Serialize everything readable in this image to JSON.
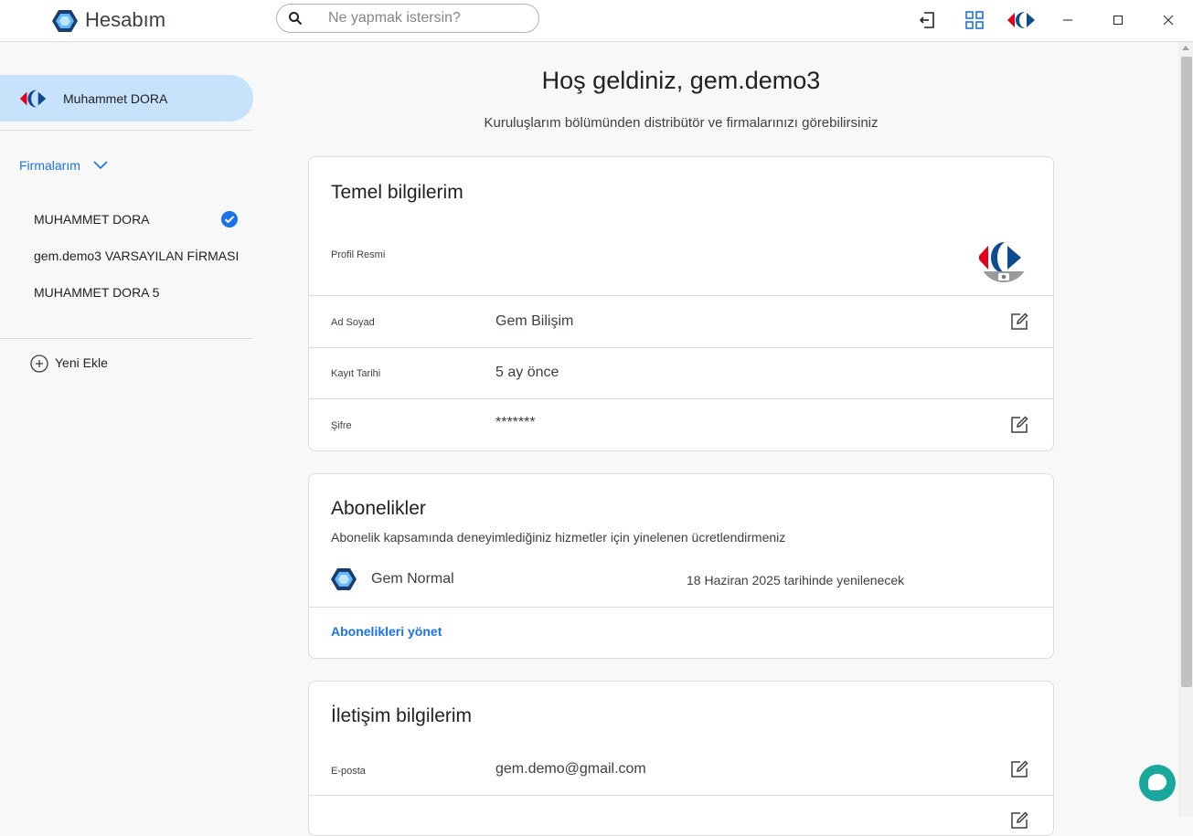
{
  "app": {
    "title": "Hesabım"
  },
  "search": {
    "placeholder": "Ne yapmak istersin?"
  },
  "sidebar": {
    "user_name": "Muhammet DORA",
    "firms_label": "Firmalarım",
    "firms": [
      {
        "name": "MUHAMMET DORA",
        "selected": true
      },
      {
        "name": "gem.demo3 VARSAYILAN FİRMASI",
        "selected": false
      },
      {
        "name": "MUHAMMET DORA 5",
        "selected": false
      }
    ],
    "add_label": "Yeni Ekle"
  },
  "main": {
    "welcome": "Hoş geldiniz, gem.demo3",
    "welcome_sub": "Kuruluşlarım bölümünden distribütör ve firmalarınızı görebilirsiniz",
    "basic": {
      "title": "Temel bilgilerim",
      "profile_label": "Profil Resmi",
      "rows": [
        {
          "label": "Ad Soyad",
          "value": "Gem Bilişim"
        },
        {
          "label": "Kayıt Tarihi",
          "value": "5 ay önce"
        },
        {
          "label": "Şifre",
          "value": "*******"
        }
      ]
    },
    "subscriptions": {
      "title": "Abonelikler",
      "description": "Abonelik kapsamında deneyimlediğiniz hizmetler için yinelenen ücretlendirmeniz",
      "item_name": "Gem Normal",
      "item_renewal": "18 Haziran 2025 tarihinde yenilenecek",
      "manage_link": "Abonelikleri yönet"
    },
    "contact": {
      "title": "İletişim bilgilerim",
      "email_label": "E-posta",
      "email_value": "gem.demo@gmail.com"
    }
  },
  "colors": {
    "accent": "#1a73e8",
    "selected_bg": "#c6e3fb",
    "chat": "#1aa89d"
  }
}
